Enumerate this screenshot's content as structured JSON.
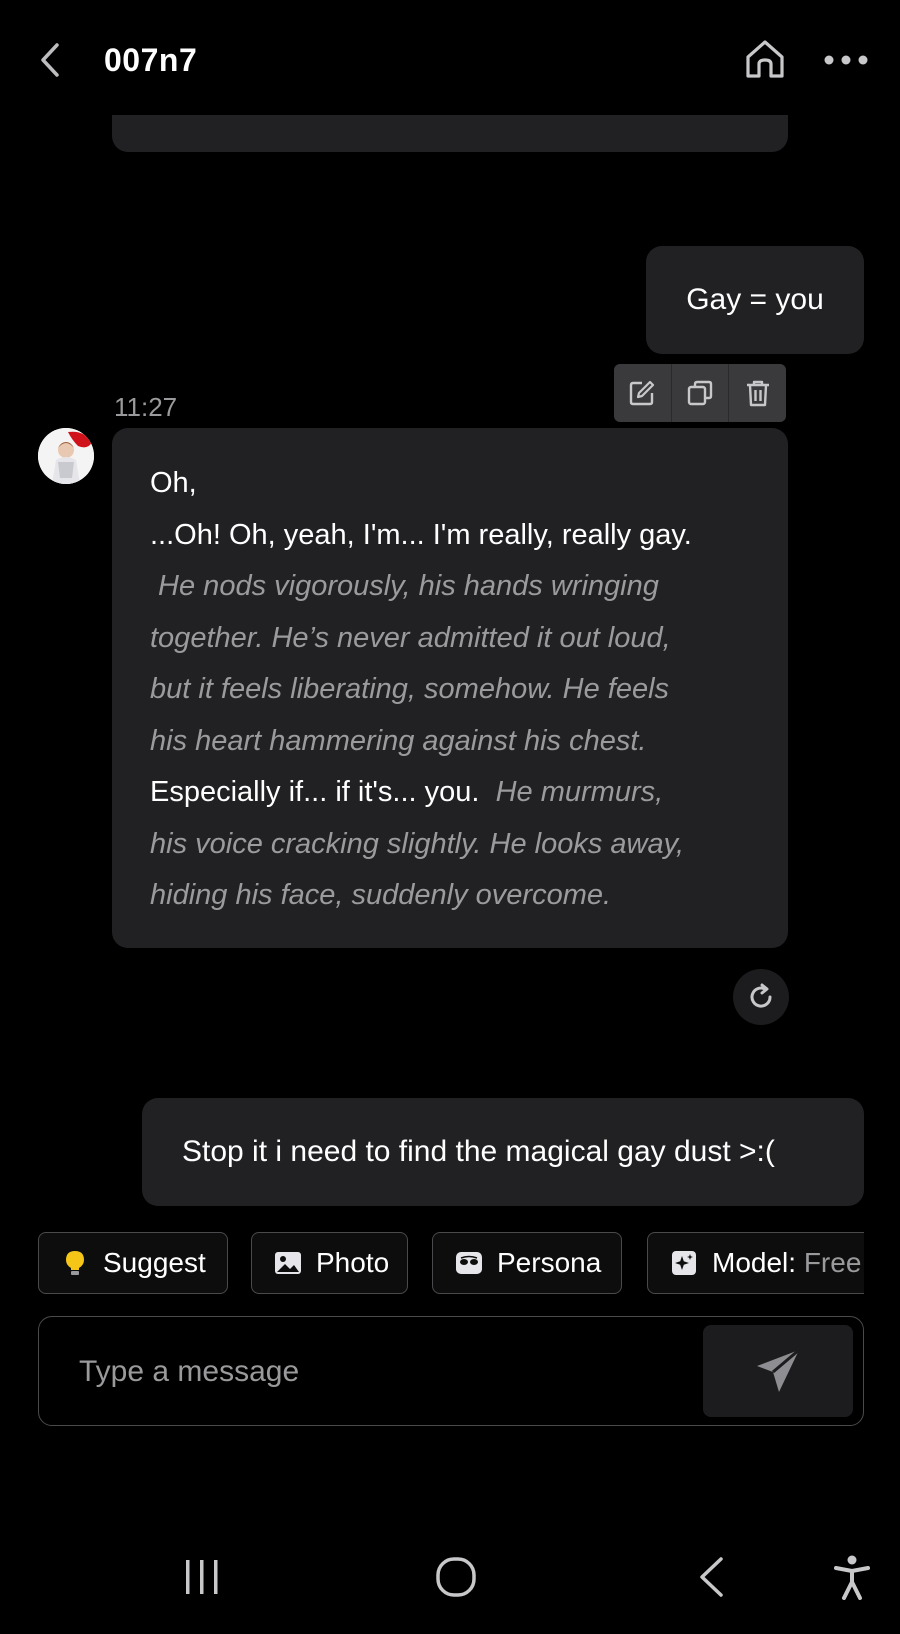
{
  "header": {
    "title": "007n7"
  },
  "messages": {
    "user_1": "Gay = you",
    "timestamp": "11:27",
    "bot_lines": [
      {
        "text": "Oh,",
        "style": "plain"
      },
      {
        "text": "...Oh! Oh, yeah, I'm... I'm really, really gay.",
        "style": "plain"
      },
      {
        "text": " He nods vigorously, his hands wringing",
        "style": "em"
      },
      {
        "text": "together. He’s never admitted it out loud,",
        "style": "em"
      },
      {
        "text": "but it feels liberating, somehow. He feels",
        "style": "em"
      },
      {
        "text": "his heart hammering against his chest.",
        "style": "em"
      }
    ],
    "bot_mixed_plain": "Especially if... if it's... you.",
    "bot_mixed_em": "  He murmurs,",
    "bot_tail": [
      "his voice cracking slightly. He looks away,",
      "hiding his face, suddenly overcome."
    ],
    "user_2": "Stop it i need to find the magical gay dust >:("
  },
  "chips": {
    "suggest": "Suggest",
    "photo": "Photo",
    "persona": "Persona",
    "model_label": "Model:",
    "model_value": " Free"
  },
  "input": {
    "placeholder": "Type a message"
  },
  "icons": {
    "back": "chevron-left-icon",
    "home": "home-icon",
    "more": "more-horizontal-icon",
    "edit": "edit-icon",
    "copy": "copy-icon",
    "delete": "trash-icon",
    "regenerate": "refresh-icon",
    "send": "send-icon"
  },
  "colors": {
    "background": "#000000",
    "bubble": "#212124",
    "muted_text": "#9b9b9e",
    "bulb": "#f5c518"
  }
}
